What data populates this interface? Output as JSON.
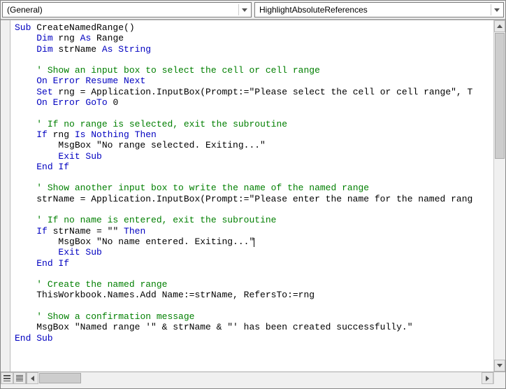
{
  "toolbar": {
    "object_dropdown": "(General)",
    "procedure_dropdown": "HighlightAbsoluteReferences"
  },
  "code": {
    "lines": [
      {
        "segs": [
          {
            "t": "Sub",
            "c": "kw"
          },
          {
            "t": " CreateNamedRange()"
          }
        ]
      },
      {
        "segs": [
          {
            "t": "    "
          },
          {
            "t": "Dim",
            "c": "kw"
          },
          {
            "t": " rng "
          },
          {
            "t": "As",
            "c": "kw"
          },
          {
            "t": " Range"
          }
        ]
      },
      {
        "segs": [
          {
            "t": "    "
          },
          {
            "t": "Dim",
            "c": "kw"
          },
          {
            "t": " strName "
          },
          {
            "t": "As String",
            "c": "kw"
          }
        ]
      },
      {
        "segs": [
          {
            "t": ""
          }
        ]
      },
      {
        "segs": [
          {
            "t": "    "
          },
          {
            "t": "' Show an input box to select the cell or cell range",
            "c": "cm"
          }
        ]
      },
      {
        "segs": [
          {
            "t": "    "
          },
          {
            "t": "On Error Resume Next",
            "c": "kw"
          }
        ]
      },
      {
        "segs": [
          {
            "t": "    "
          },
          {
            "t": "Set",
            "c": "kw"
          },
          {
            "t": " rng = Application.InputBox(Prompt:=\"Please select the cell or cell range\", T"
          }
        ]
      },
      {
        "segs": [
          {
            "t": "    "
          },
          {
            "t": "On Error GoTo",
            "c": "kw"
          },
          {
            "t": " 0"
          }
        ]
      },
      {
        "segs": [
          {
            "t": ""
          }
        ]
      },
      {
        "segs": [
          {
            "t": "    "
          },
          {
            "t": "' If no range is selected, exit the subroutine",
            "c": "cm"
          }
        ]
      },
      {
        "segs": [
          {
            "t": "    "
          },
          {
            "t": "If",
            "c": "kw"
          },
          {
            "t": " rng "
          },
          {
            "t": "Is Nothing Then",
            "c": "kw"
          }
        ]
      },
      {
        "segs": [
          {
            "t": "        MsgBox \"No range selected. Exiting...\""
          }
        ]
      },
      {
        "segs": [
          {
            "t": "        "
          },
          {
            "t": "Exit Sub",
            "c": "kw"
          }
        ]
      },
      {
        "segs": [
          {
            "t": "    "
          },
          {
            "t": "End If",
            "c": "kw"
          }
        ]
      },
      {
        "segs": [
          {
            "t": ""
          }
        ]
      },
      {
        "segs": [
          {
            "t": "    "
          },
          {
            "t": "' Show another input box to write the name of the named range",
            "c": "cm"
          }
        ]
      },
      {
        "segs": [
          {
            "t": "    strName = Application.InputBox(Prompt:=\"Please enter the name for the named rang"
          }
        ]
      },
      {
        "segs": [
          {
            "t": ""
          }
        ]
      },
      {
        "segs": [
          {
            "t": "    "
          },
          {
            "t": "' If no name is entered, exit the subroutine",
            "c": "cm"
          }
        ]
      },
      {
        "segs": [
          {
            "t": "    "
          },
          {
            "t": "If",
            "c": "kw"
          },
          {
            "t": " strName = \"\" "
          },
          {
            "t": "Then",
            "c": "kw"
          }
        ]
      },
      {
        "segs": [
          {
            "t": "        MsgBox \"No name entered. Exiting...\""
          }
        ],
        "cursor": true
      },
      {
        "segs": [
          {
            "t": "        "
          },
          {
            "t": "Exit Sub",
            "c": "kw"
          }
        ]
      },
      {
        "segs": [
          {
            "t": "    "
          },
          {
            "t": "End If",
            "c": "kw"
          }
        ]
      },
      {
        "segs": [
          {
            "t": ""
          }
        ]
      },
      {
        "segs": [
          {
            "t": "    "
          },
          {
            "t": "' Create the named range",
            "c": "cm"
          }
        ]
      },
      {
        "segs": [
          {
            "t": "    ThisWorkbook.Names.Add Name:=strName, RefersTo:=rng"
          }
        ]
      },
      {
        "segs": [
          {
            "t": ""
          }
        ]
      },
      {
        "segs": [
          {
            "t": "    "
          },
          {
            "t": "' Show a confirmation message",
            "c": "cm"
          }
        ]
      },
      {
        "segs": [
          {
            "t": "    MsgBox \"Named range '\" & strName & \"' has been created successfully.\""
          }
        ]
      },
      {
        "segs": [
          {
            "t": "End Sub",
            "c": "kw"
          }
        ]
      },
      {
        "segs": [
          {
            "t": ""
          }
        ]
      }
    ]
  }
}
